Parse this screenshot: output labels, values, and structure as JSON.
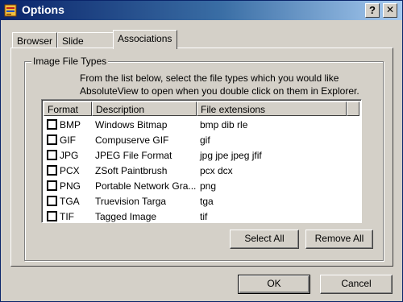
{
  "window": {
    "title": "Options"
  },
  "title_buttons": {
    "help": "?",
    "close": "✕"
  },
  "tabs": [
    {
      "label": "Browser",
      "active": false
    },
    {
      "label": "Slide Show",
      "active": false
    },
    {
      "label": "Associations",
      "active": true
    }
  ],
  "group": {
    "label": "Image File Types",
    "description_line1": "From the list below, select the file types which you would like",
    "description_line2": "AbsoluteView to open when you double click on them in Explorer."
  },
  "list": {
    "columns": [
      "Format",
      "Description",
      "File extensions"
    ],
    "rows": [
      {
        "format": "BMP",
        "description": "Windows Bitmap",
        "extensions": "bmp dib rle",
        "checked": false
      },
      {
        "format": "GIF",
        "description": "Compuserve GIF",
        "extensions": "gif",
        "checked": false
      },
      {
        "format": "JPG",
        "description": "JPEG File Format",
        "extensions": "jpg jpe jpeg jfif",
        "checked": false
      },
      {
        "format": "PCX",
        "description": "ZSoft Paintbrush",
        "extensions": "pcx dcx",
        "checked": false
      },
      {
        "format": "PNG",
        "description": "Portable Network Gra...",
        "extensions": "png",
        "checked": false
      },
      {
        "format": "TGA",
        "description": "Truevision Targa",
        "extensions": "tga",
        "checked": false
      },
      {
        "format": "TIF",
        "description": "Tagged Image",
        "extensions": "tif",
        "checked": false
      }
    ]
  },
  "buttons": {
    "select_all": "Select All",
    "remove_all": "Remove All",
    "ok": "OK",
    "cancel": "Cancel"
  },
  "icons": {
    "app": "app-options-icon",
    "checkbox": "checkbox-unchecked"
  },
  "colors": {
    "titlebar_start": "#0a246a",
    "titlebar_end": "#a6caf0",
    "dialog_face": "#d4d0c8"
  }
}
